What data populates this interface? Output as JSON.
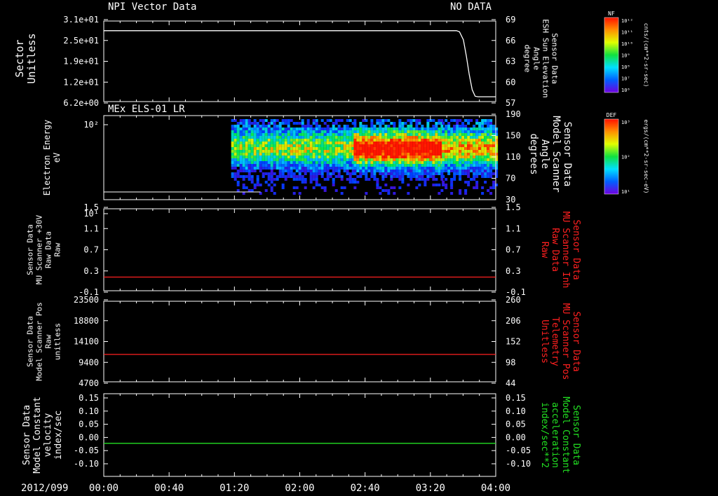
{
  "date_label": "2012/099",
  "x_ticks": [
    "00:00",
    "00:40",
    "01:20",
    "02:00",
    "02:40",
    "03:20",
    "04:00"
  ],
  "colors": {
    "red": "#ff2020",
    "green": "#22e022",
    "white": "#ffffff"
  },
  "chart_data": [
    {
      "type": "line",
      "title_left": "NPI Vector Data",
      "title_right": "NO DATA",
      "ylabel_left": [
        "Sector",
        "Unitless"
      ],
      "ylabel_right": [
        "Sensor Data",
        "ESH Sun Elevation",
        "Angle",
        "degree"
      ],
      "yticks_left": [
        "3.1e+01",
        "2.5e+01",
        "1.9e+01",
        "1.2e+01",
        "6.2e+00"
      ],
      "yticks_right": [
        "69",
        "66",
        "63",
        "60",
        "57"
      ],
      "ylim_right": [
        54,
        69
      ],
      "series": [
        {
          "axis": "right",
          "color": "#ffffff",
          "x": [
            0,
            3.6,
            3.63,
            3.67,
            3.7,
            3.73,
            3.76,
            3.79,
            3.82,
            4.0
          ],
          "y": [
            67.2,
            67.2,
            67.0,
            65.5,
            62.5,
            59.0,
            56.2,
            55.0,
            54.9,
            54.9
          ]
        }
      ]
    },
    {
      "type": "heatmap",
      "title_left": "MEx ELS-01 LR",
      "ylabel_left": [
        "Electron Energy",
        "eV"
      ],
      "ylabel_right": [
        "Sensor Data",
        "Model Scanner",
        "Angle",
        "degrees"
      ],
      "yticks_left": [
        "10²",
        "10¹"
      ],
      "yticks_right": [
        "190",
        "150",
        "110",
        "70",
        "30"
      ],
      "ylim_right": [
        10,
        190
      ],
      "line": {
        "y": 1.5,
        "x_end": 1.6
      },
      "regions": [
        {
          "x": [
            1.3,
            2.55
          ],
          "peak": 0.55
        },
        {
          "x": [
            2.55,
            3.45
          ],
          "peak": 1.0
        },
        {
          "x": [
            3.45,
            4.0
          ],
          "peak": 0.72
        }
      ]
    },
    {
      "type": "line",
      "ylabel_left": [
        "Sensor Data",
        "MU Scanner +30V",
        "Raw Data",
        "Raw"
      ],
      "ylabel_right": [
        "Sensor Data",
        "MU Scanner Inh",
        "Raw Data",
        "Raw"
      ],
      "yticks_left": [
        "1.5",
        "1.1",
        "0.7",
        "0.3",
        "-0.1"
      ],
      "yticks_right": [
        "1.5",
        "1.1",
        "0.7",
        "0.3",
        "-0.1"
      ],
      "ylim": [
        -0.3,
        1.5
      ],
      "series": [
        {
          "color": "#ff2020",
          "x": [
            0,
            4
          ],
          "y": [
            0,
            0
          ]
        }
      ]
    },
    {
      "type": "line",
      "ylabel_left": [
        "Sensor Data",
        "Model Scanner Pos",
        "Raw",
        "unitless"
      ],
      "ylabel_right": [
        "Sensor Data",
        "MU Scanner Pos",
        "Telemetry",
        "Unitless"
      ],
      "yticks_left": [
        "23500",
        "18800",
        "14100",
        "9400",
        "4700"
      ],
      "yticks_right": [
        "260",
        "206",
        "152",
        "98",
        "44"
      ],
      "ylim": [
        0,
        23500
      ],
      "series": [
        {
          "color": "#ff2020",
          "x": [
            0,
            4
          ],
          "y": [
            8000,
            8000
          ]
        }
      ]
    },
    {
      "type": "line",
      "ylabel_left": [
        "Sensor Data",
        "Model Constant",
        "velocity",
        "index/sec"
      ],
      "ylabel_right": [
        "Sensor Data",
        "Model Constant",
        "acceleration",
        "index/sec**2"
      ],
      "yticks_left": [
        "0.15",
        "0.10",
        "0.05",
        "0.00",
        "-0.05",
        "-0.10"
      ],
      "yticks_right": [
        "0.15",
        "0.10",
        "0.05",
        "0.00",
        "-0.05",
        "-0.10"
      ],
      "ylim": [
        -0.1,
        0.15
      ],
      "series": [
        {
          "color": "#22e022",
          "x": [
            0,
            4
          ],
          "y": [
            0,
            0
          ]
        }
      ]
    }
  ],
  "colorbars": [
    {
      "label": "NF",
      "units": "cnts/(cm**2-sr-sec)",
      "ticks": [
        "10¹²",
        "10¹¹",
        "10¹⁰",
        "10⁹",
        "10⁸",
        "10⁷",
        "10⁶"
      ]
    },
    {
      "label": "DEF",
      "units": "ergs/(cm**2-sr-sec-eV)",
      "ticks": [
        "10³",
        "10²",
        "10¹"
      ]
    }
  ]
}
